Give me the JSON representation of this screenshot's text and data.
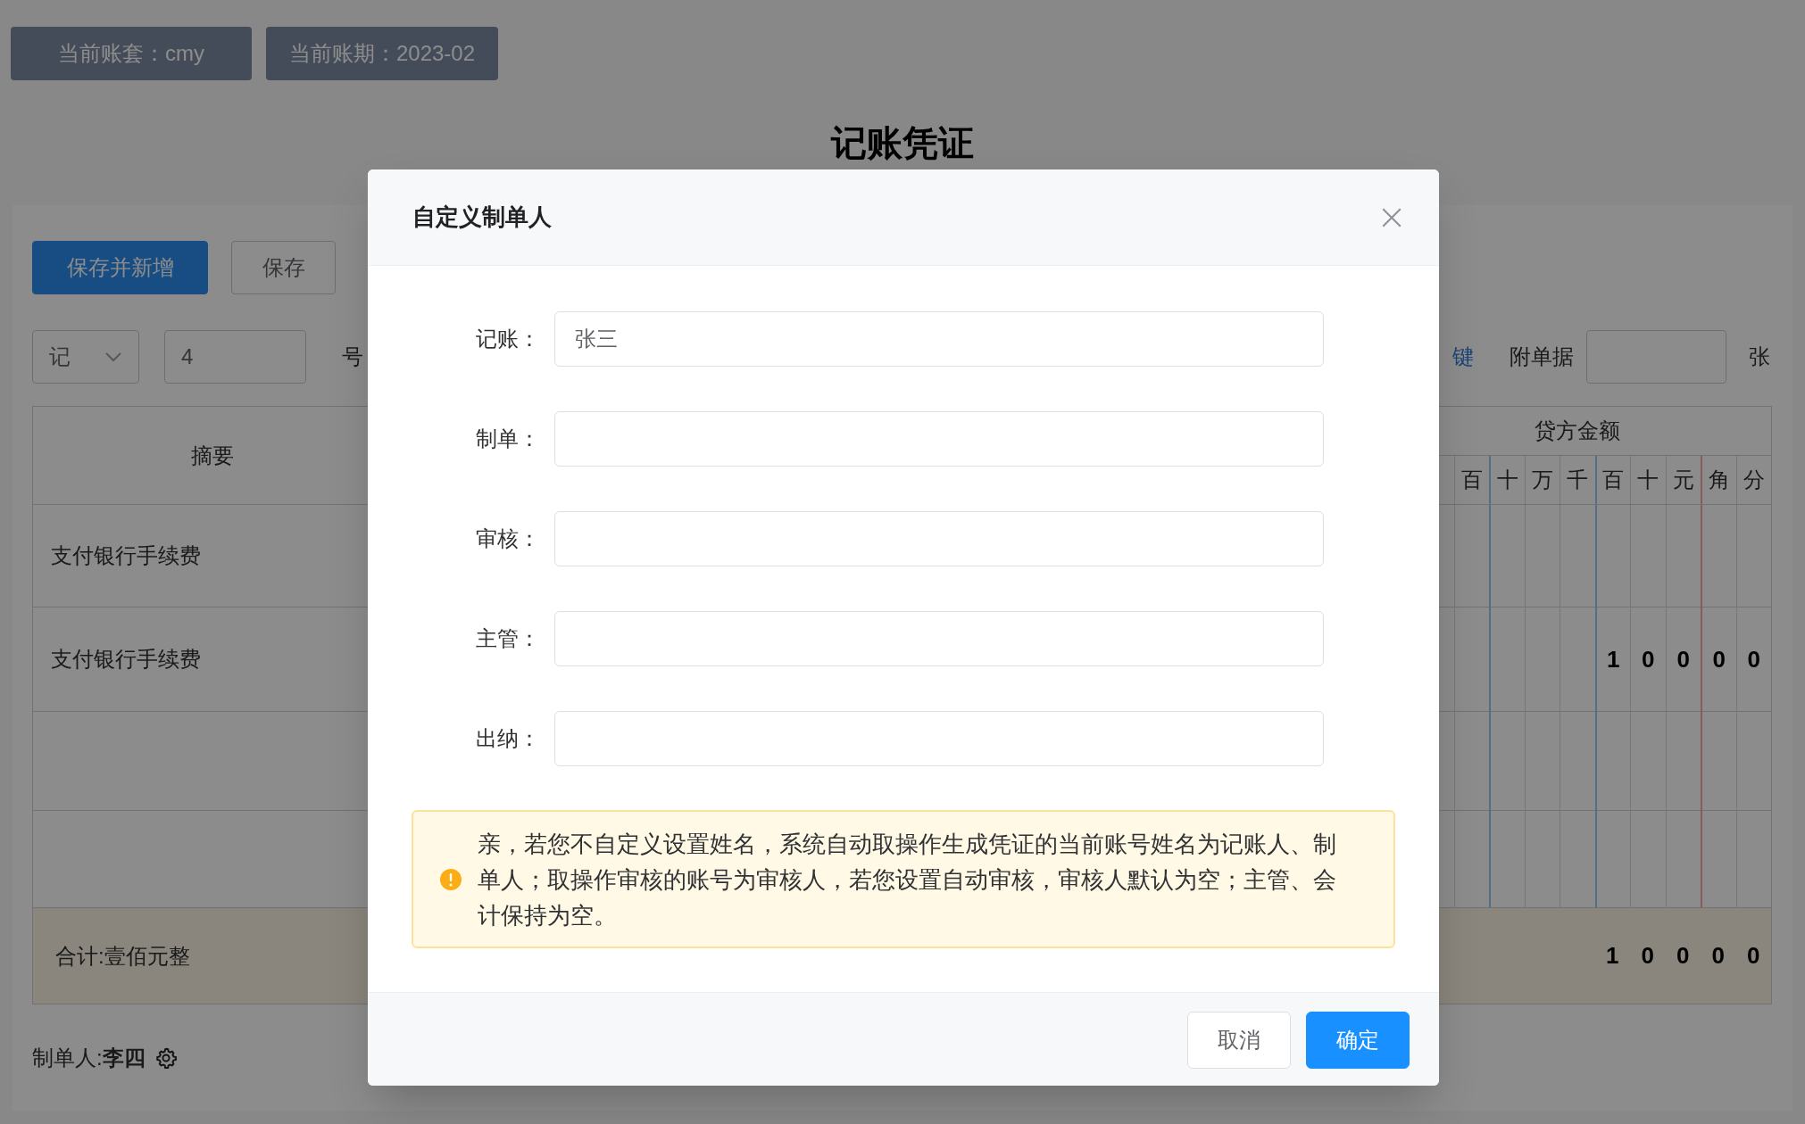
{
  "header_tags": [
    {
      "label": "当前账套：cmy"
    },
    {
      "label": "当前账期：2023-02"
    }
  ],
  "page_title": "记账凭证",
  "toolbar": {
    "buttons": [
      {
        "label": "保存并新增",
        "kind": "primary"
      },
      {
        "label": "保存",
        "kind": "default"
      }
    ]
  },
  "voucher_meta": {
    "type_select": "记",
    "number": "4",
    "number_suffix": "号",
    "shortcut_link": "键",
    "attachments_label": "附单据",
    "attachments_suffix": "张"
  },
  "table": {
    "summary_header": "摘要",
    "credit_header": "贷方金额",
    "digit_headers": [
      "百",
      "十",
      "万",
      "千",
      "百",
      "十",
      "元",
      "角",
      "分"
    ],
    "rows": [
      {
        "summary": "支付银行手续费"
      },
      {
        "summary": "支付银行手续费",
        "credit_digits": [
          "1",
          "0",
          "0",
          "0",
          "0"
        ]
      },
      {},
      {}
    ],
    "total": {
      "label": "合计:壹佰元整",
      "credit_digits": [
        "1",
        "0",
        "0",
        "0",
        "0"
      ]
    }
  },
  "preparer": {
    "label": "制单人:",
    "name": "李四"
  },
  "dialog": {
    "title": "自定义制单人",
    "fields": [
      {
        "label": "记账：",
        "value": "张三"
      },
      {
        "label": "制单："
      },
      {
        "label": "审核："
      },
      {
        "label": "主管："
      },
      {
        "label": "出纳："
      }
    ],
    "notice": "亲，若您不自定义设置姓名，系统自动取操作生成凭证的当前账号姓名为记账人、制单人；取操作审核的账号为审核人，若您设置自动审核，审核人默认为空；主管、会计保持为空。",
    "buttons": [
      {
        "label": "取消",
        "kind": "default"
      },
      {
        "label": "确定",
        "kind": "primary"
      }
    ]
  }
}
